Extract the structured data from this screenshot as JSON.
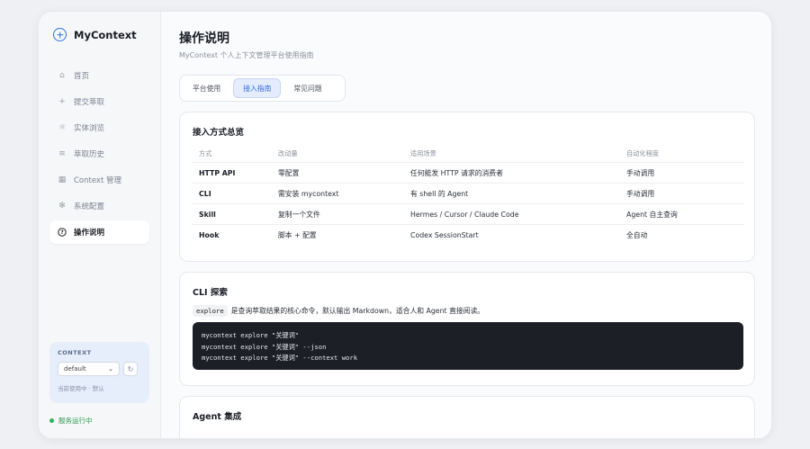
{
  "brand": {
    "name": "MyContext",
    "icon": "plus-circle-icon"
  },
  "nav": {
    "items": [
      {
        "label": "首页",
        "icon": "home-icon",
        "glyph": "⌂"
      },
      {
        "label": "提交萃取",
        "icon": "plus-icon",
        "glyph": "+"
      },
      {
        "label": "实体浏览",
        "icon": "sun-icon",
        "glyph": "☼"
      },
      {
        "label": "萃取历史",
        "icon": "list-icon",
        "glyph": "≡"
      },
      {
        "label": "Context 管理",
        "icon": "grid-icon",
        "glyph": "▦"
      },
      {
        "label": "系统配置",
        "icon": "gear-icon",
        "glyph": "✻"
      },
      {
        "label": "操作说明",
        "icon": "help-icon",
        "glyph": "?",
        "active": true
      }
    ]
  },
  "context": {
    "label": "CONTEXT",
    "selected": "default",
    "hint": "当前使用中 · 默认"
  },
  "status": {
    "text": "服务运行中",
    "color": "#2fb45a"
  },
  "page": {
    "title": "操作说明",
    "subtitle": "MyContext 个人上下文管理平台使用指南"
  },
  "tabs": [
    {
      "label": "平台使用"
    },
    {
      "label": "接入指南",
      "active": true
    },
    {
      "label": "常见问题"
    }
  ],
  "overview": {
    "title": "接入方式总览",
    "headers": [
      "方式",
      "改动量",
      "适用场景",
      "自动化程度"
    ],
    "rows": [
      [
        "HTTP API",
        "零配置",
        "任何能发 HTTP 请求的消费者",
        "手动调用"
      ],
      [
        "CLI",
        "需安装 mycontext",
        "有 shell 的 Agent",
        "手动调用"
      ],
      [
        "Skill",
        "复制一个文件",
        "Hermes / Cursor / Claude Code",
        "Agent 自主查询"
      ],
      [
        "Hook",
        "脚本 + 配置",
        "Codex SessionStart",
        "全自动"
      ]
    ]
  },
  "cli": {
    "title": "CLI 探索",
    "command": "explore",
    "desc": "是查询萃取结果的核心命令，默认输出 Markdown，适合人和 Agent 直接阅读。",
    "code": [
      "mycontext explore \"关键词\"",
      "mycontext explore \"关键词\" --json",
      "mycontext explore \"关键词\" --context work"
    ]
  },
  "agent": {
    "title": "Agent 集成"
  },
  "colors": {
    "accent": "#2f6fe4",
    "sidebar": "#f6f7f9",
    "code_bg": "#1c1f26"
  }
}
